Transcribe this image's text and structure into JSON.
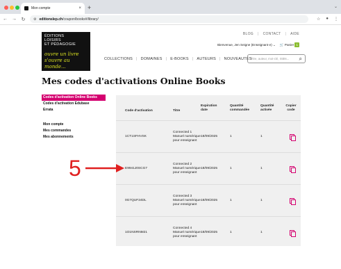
{
  "browser": {
    "tab_title": "Mon compte",
    "tab_close": "×",
    "new_tab": "+",
    "tab_chevron": "⌄",
    "url_host": "editionslep.ch",
    "url_path": "/coupon/books#/library/",
    "back": "←",
    "forward": "→",
    "reload": "↻",
    "site_info": "⚙",
    "star": "☆",
    "profile": "●",
    "menu": "⋮"
  },
  "logo": {
    "line1": "ÉDITIONS",
    "line2": "LOISIRS",
    "line3": "ET PÉDAGOGIE",
    "script1": "ouvre un livre",
    "script2": "s'ouvre au monde..."
  },
  "header": {
    "top_links": [
      "BLOG",
      "CONTACT",
      "AIDE"
    ],
    "account": "Bienvenue, Jen Seigne (Enseignant·e)",
    "account_chevron": "⌄",
    "cart_label": "Panier",
    "cart_count": "1",
    "nav": [
      "COLLECTIONS",
      "DOMAINES",
      "E-BOOKS",
      "AUTEURS",
      "NOUVEAUTÉS"
    ],
    "search_placeholder": "Titre, auteur, mot-clé, ISBN..."
  },
  "page": {
    "title": "Mes codes d'activations Online Books"
  },
  "sidebar": {
    "items": [
      {
        "label": "Codes d'activation Online Books",
        "active": true
      },
      {
        "label": "Codes d'activation Edubase",
        "active": false
      },
      {
        "label": "Errata",
        "active": false
      },
      {
        "label": "Mon compte",
        "active": false
      },
      {
        "label": "Mes commandes",
        "active": false
      },
      {
        "label": "Mes abonnements",
        "active": false
      }
    ]
  },
  "table": {
    "headers": {
      "code": "Code d'activation",
      "title": "Titre",
      "expiry": "Expiration date",
      "qty_ordered": "Quantité commandée",
      "qty_activated": "Quantité activée",
      "copy": "Copier code"
    },
    "rows": [
      {
        "code": "1CT1SFHVSK",
        "title": "Connected 1 Manuel numérique pour enseignant",
        "expiry": "18/09/2025",
        "qty_ordered": "1",
        "qty_activated": "1"
      },
      {
        "code": "E9941J0SCG7",
        "title": "Connected 2 Manuel numérique pour enseignant",
        "expiry": "18/09/2025",
        "qty_ordered": "1",
        "qty_activated": "1"
      },
      {
        "code": "0G7QUF24DL",
        "title": "Connected 3 Manuel numérique pour enseignant",
        "expiry": "18/09/2025",
        "qty_ordered": "1",
        "qty_activated": "1"
      },
      {
        "code": "1O1NSRNM21",
        "title": "Connected 4 Manuel numérique pour enseignant",
        "expiry": "18/09/2025",
        "qty_ordered": "1",
        "qty_activated": "1"
      }
    ]
  },
  "annotation": {
    "number": "5"
  },
  "colors": {
    "accent": "#d4006f",
    "cart": "#8bbd31",
    "annotation": "#e02020"
  }
}
